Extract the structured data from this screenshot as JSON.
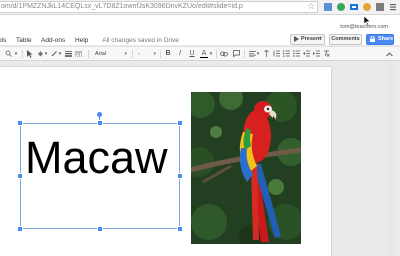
{
  "browser": {
    "url": "om/d/1PMZZNJkL14CEQLsx_vL7D8Z1ownfJsK3096DnvKZUo/edit#slide=id.p"
  },
  "account": {
    "email": "tom@teachers.com"
  },
  "menu": {
    "items": [
      "ols",
      "Table",
      "Add-ons",
      "Help"
    ],
    "saved_status": "All changes saved in Drive"
  },
  "actions": {
    "present": "Present",
    "comments": "Comments",
    "share": "Share"
  },
  "toolbar": {
    "font": "Arial",
    "size": "-",
    "bold": "B",
    "italic": "I",
    "underline": "U",
    "text_color": "A"
  },
  "slide": {
    "title_text": "Macaw",
    "image_subject": "scarlet macaw photo"
  },
  "colors": {
    "share_blue": "#4a8af4",
    "selection_blue": "#7aa7e0",
    "canvas_gray": "#ebebeb"
  }
}
